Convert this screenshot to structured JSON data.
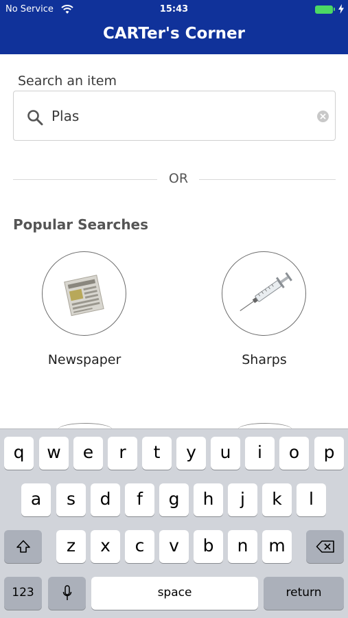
{
  "status_bar": {
    "carrier": "No Service",
    "time": "15:43"
  },
  "header": {
    "title": "CARTer's Corner"
  },
  "search": {
    "label": "Search an item",
    "value": "Plas"
  },
  "divider": {
    "text": "OR"
  },
  "popular": {
    "title": "Popular Searches",
    "items": [
      {
        "label": "Newspaper",
        "icon": "newspaper-image"
      },
      {
        "label": "Sharps",
        "icon": "syringe-image"
      }
    ]
  },
  "keyboard": {
    "row1": [
      "q",
      "w",
      "e",
      "r",
      "t",
      "y",
      "u",
      "i",
      "o",
      "p"
    ],
    "row2": [
      "a",
      "s",
      "d",
      "f",
      "g",
      "h",
      "j",
      "k",
      "l"
    ],
    "row3": [
      "z",
      "x",
      "c",
      "v",
      "b",
      "n",
      "m"
    ],
    "numbers_label": "123",
    "space_label": "space",
    "return_label": "return"
  },
  "colors": {
    "header_bg": "#10329a",
    "battery": "#4cd964",
    "keyboard_bg": "#d1d4da"
  }
}
